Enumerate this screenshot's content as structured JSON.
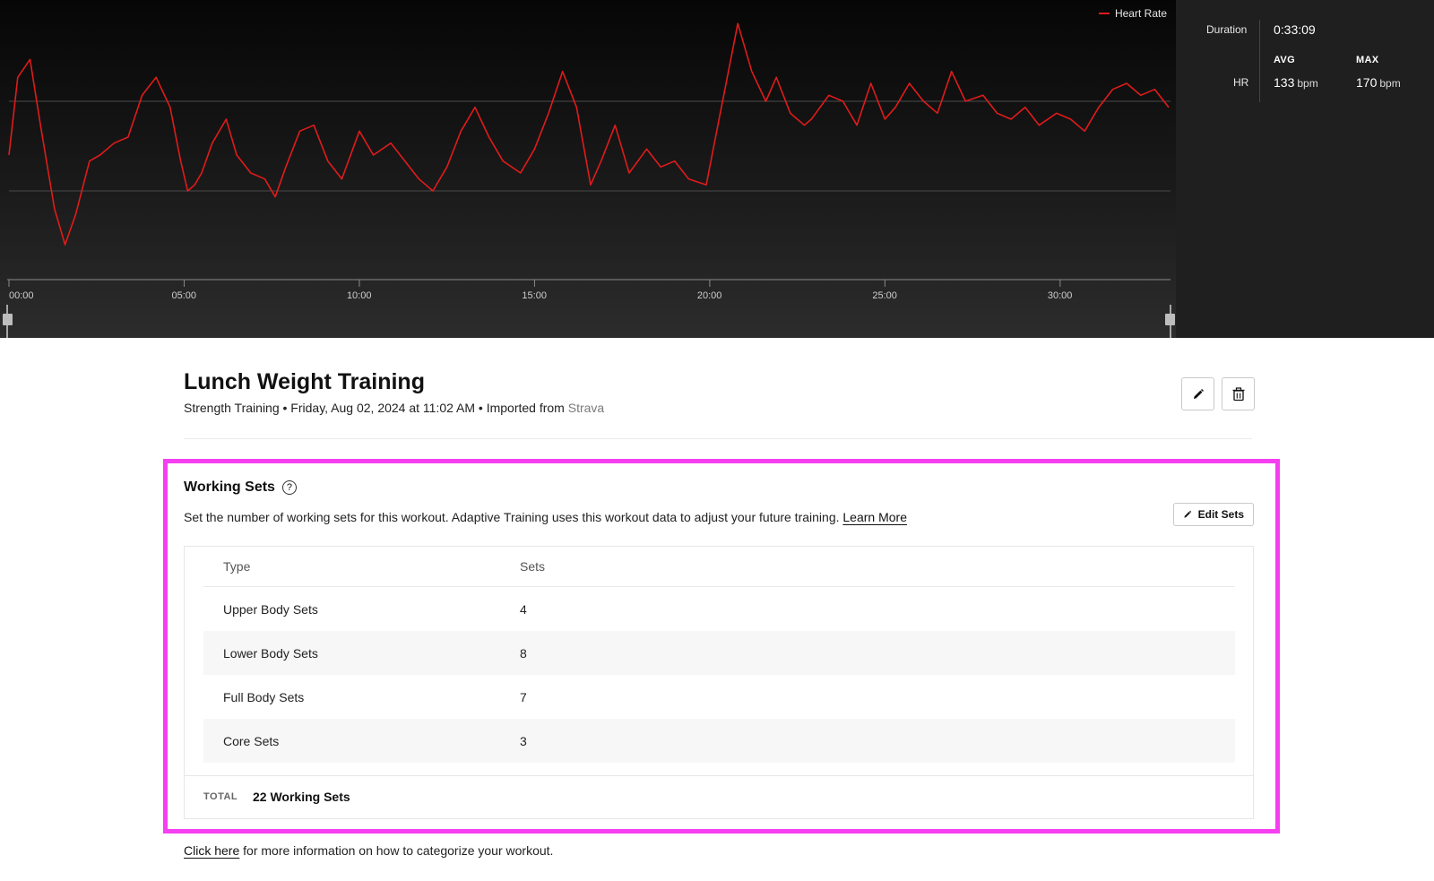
{
  "chart": {
    "legend_label": "Heart Rate",
    "line_color": "#e01b1b",
    "x_ticks": [
      "00:00",
      "05:00",
      "10:00",
      "15:00",
      "20:00",
      "25:00",
      "30:00"
    ]
  },
  "chart_data": {
    "type": "line",
    "xlabel": "",
    "ylabel": "",
    "xlim": [
      0,
      33.15
    ],
    "grid": true,
    "legend": "top-right",
    "x_ticks": [
      "00:00",
      "05:00",
      "10:00",
      "15:00",
      "20:00",
      "25:00",
      "30:00"
    ],
    "series": [
      {
        "name": "Heart Rate",
        "color": "#e01b1b",
        "x": [
          0,
          0.25,
          0.6,
          0.9,
          1.3,
          1.6,
          1.9,
          2.3,
          2.6,
          3.0,
          3.4,
          3.8,
          4.2,
          4.6,
          4.9,
          5.1,
          5.3,
          5.5,
          5.8,
          6.2,
          6.5,
          6.9,
          7.3,
          7.6,
          7.9,
          8.3,
          8.7,
          9.1,
          9.5,
          10.0,
          10.4,
          10.9,
          11.3,
          11.7,
          12.1,
          12.5,
          12.9,
          13.3,
          13.7,
          14.1,
          14.6,
          15.0,
          15.4,
          15.8,
          16.2,
          16.6,
          16.9,
          17.3,
          17.7,
          18.2,
          18.6,
          19.0,
          19.4,
          19.9,
          20.3,
          20.8,
          21.2,
          21.6,
          21.9,
          22.3,
          22.7,
          22.9,
          23.4,
          23.8,
          24.2,
          24.6,
          25.0,
          25.3,
          25.7,
          26.1,
          26.5,
          26.9,
          27.3,
          27.8,
          28.2,
          28.6,
          29.0,
          29.4,
          29.9,
          30.3,
          30.7,
          31.1,
          31.5,
          31.9,
          32.3,
          32.7,
          33.1
        ],
        "y": [
          141,
          154,
          157,
          146,
          132,
          126,
          131,
          140,
          141,
          143,
          144,
          151,
          154,
          149,
          140,
          135,
          136,
          138,
          143,
          147,
          141,
          138,
          137,
          134,
          139,
          145,
          146,
          140,
          137,
          145,
          141,
          143,
          140,
          137,
          135,
          139,
          145,
          149,
          144,
          140,
          138,
          142,
          148,
          155,
          149,
          136,
          140,
          146,
          138,
          142,
          139,
          140,
          137,
          136,
          148,
          163,
          155,
          150,
          154,
          148,
          146,
          147,
          151,
          150,
          146,
          153,
          147,
          149,
          153,
          150,
          148,
          155,
          150,
          151,
          148,
          147,
          149,
          146,
          148,
          147,
          145,
          149,
          152,
          153,
          151,
          152,
          149
        ]
      }
    ]
  },
  "stats": {
    "duration_label": "Duration",
    "duration_value": "0:33:09",
    "avg_label": "AVG",
    "max_label": "MAX",
    "hr_label": "HR",
    "hr_avg": "133",
    "hr_max": "170",
    "unit": "bpm"
  },
  "workout": {
    "title": "Lunch Weight Training",
    "meta_prefix": "Strength Training • Friday, Aug 02, 2024 at 11:02 AM • Imported from ",
    "source": "Strava"
  },
  "working_sets": {
    "title": "Working Sets",
    "help_glyph": "?",
    "description": "Set the number of working sets for this workout. Adaptive Training uses this workout data to adjust your future training. ",
    "learn_more": "Learn More",
    "edit_label": "Edit Sets",
    "columns": [
      "Type",
      "Sets"
    ],
    "rows": [
      {
        "type": "Upper Body Sets",
        "sets": "4"
      },
      {
        "type": "Lower Body Sets",
        "sets": "8"
      },
      {
        "type": "Full Body Sets",
        "sets": "7"
      },
      {
        "type": "Core Sets",
        "sets": "3"
      }
    ],
    "total_label": "TOTAL",
    "total_value": "22 Working Sets"
  },
  "footer": {
    "link": "Click here",
    "text": " for more information on how to categorize your workout."
  },
  "colors": {
    "highlight": "#f53ff0",
    "chart_bg": "#111111",
    "panel_bg": "#1f1f1f"
  }
}
